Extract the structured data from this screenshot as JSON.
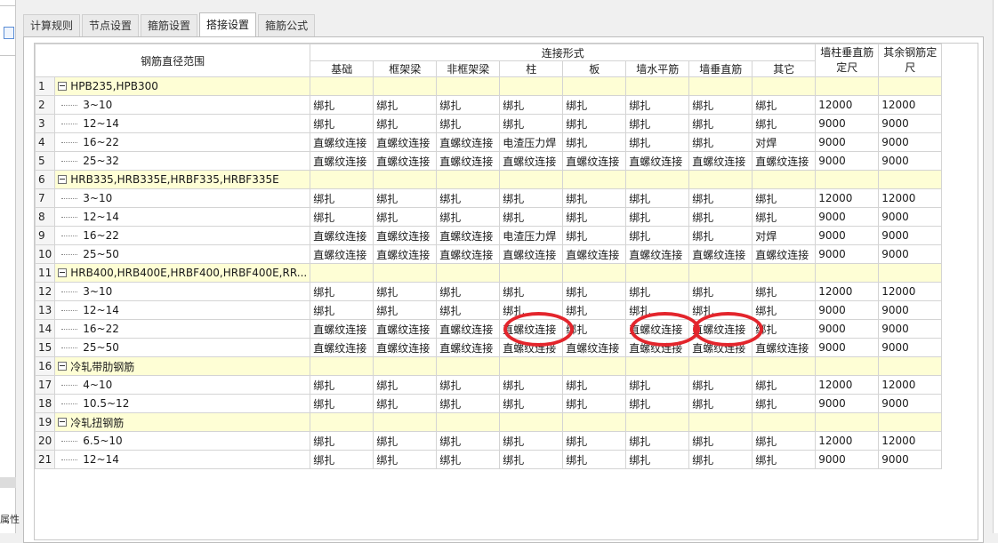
{
  "left_panel": {
    "bottom_text": "属性"
  },
  "tabs": [
    {
      "label": "计算规则"
    },
    {
      "label": "节点设置"
    },
    {
      "label": "箍筋设置"
    },
    {
      "label": "搭接设置",
      "active": true
    },
    {
      "label": "箍筋公式"
    }
  ],
  "table": {
    "headers": {
      "range": "钢筋直径范围",
      "group": "连接形式",
      "sub": [
        "基础",
        "框架梁",
        "非框架梁",
        "柱",
        "板",
        "墙水平筋",
        "墙垂直筋",
        "其它"
      ],
      "wall_col": "墙柱垂直筋定尺",
      "other_col": "其余钢筋定尺"
    },
    "rows": [
      {
        "n": "1",
        "group": true,
        "label": "HPB235,HPB300"
      },
      {
        "n": "2",
        "label": "3~10",
        "cells": [
          "绑扎",
          "绑扎",
          "绑扎",
          "绑扎",
          "绑扎",
          "绑扎",
          "绑扎",
          "绑扎",
          "12000",
          "12000"
        ]
      },
      {
        "n": "3",
        "label": "12~14",
        "cells": [
          "绑扎",
          "绑扎",
          "绑扎",
          "绑扎",
          "绑扎",
          "绑扎",
          "绑扎",
          "绑扎",
          "9000",
          "9000"
        ]
      },
      {
        "n": "4",
        "label": "16~22",
        "cells": [
          "直螺纹连接",
          "直螺纹连接",
          "直螺纹连接",
          "电渣压力焊",
          "绑扎",
          "绑扎",
          "绑扎",
          "对焊",
          "9000",
          "9000"
        ]
      },
      {
        "n": "5",
        "label": "25~32",
        "cells": [
          "直螺纹连接",
          "直螺纹连接",
          "直螺纹连接",
          "直螺纹连接",
          "直螺纹连接",
          "直螺纹连接",
          "直螺纹连接",
          "直螺纹连接",
          "9000",
          "9000"
        ]
      },
      {
        "n": "6",
        "group": true,
        "label": "HRB335,HRB335E,HRBF335,HRBF335E"
      },
      {
        "n": "7",
        "label": "3~10",
        "cells": [
          "绑扎",
          "绑扎",
          "绑扎",
          "绑扎",
          "绑扎",
          "绑扎",
          "绑扎",
          "绑扎",
          "12000",
          "12000"
        ]
      },
      {
        "n": "8",
        "label": "12~14",
        "cells": [
          "绑扎",
          "绑扎",
          "绑扎",
          "绑扎",
          "绑扎",
          "绑扎",
          "绑扎",
          "绑扎",
          "9000",
          "9000"
        ]
      },
      {
        "n": "9",
        "label": "16~22",
        "cells": [
          "直螺纹连接",
          "直螺纹连接",
          "直螺纹连接",
          "电渣压力焊",
          "绑扎",
          "绑扎",
          "绑扎",
          "对焊",
          "9000",
          "9000"
        ]
      },
      {
        "n": "10",
        "label": "25~50",
        "cells": [
          "直螺纹连接",
          "直螺纹连接",
          "直螺纹连接",
          "直螺纹连接",
          "直螺纹连接",
          "直螺纹连接",
          "直螺纹连接",
          "直螺纹连接",
          "9000",
          "9000"
        ]
      },
      {
        "n": "11",
        "group": true,
        "label": "HRB400,HRB400E,HRBF400,HRBF400E,RR..."
      },
      {
        "n": "12",
        "label": "3~10",
        "cells": [
          "绑扎",
          "绑扎",
          "绑扎",
          "绑扎",
          "绑扎",
          "绑扎",
          "绑扎",
          "绑扎",
          "12000",
          "12000"
        ]
      },
      {
        "n": "13",
        "label": "12~14",
        "cells": [
          "绑扎",
          "绑扎",
          "绑扎",
          "绑扎",
          "绑扎",
          "绑扎",
          "绑扎",
          "绑扎",
          "9000",
          "9000"
        ]
      },
      {
        "n": "14",
        "label": "16~22",
        "cells": [
          "直螺纹连接",
          "直螺纹连接",
          "直螺纹连接",
          "直螺纹连接",
          "绑扎",
          "直螺纹连接",
          "直螺纹连接",
          "绑扎",
          "9000",
          "9000"
        ]
      },
      {
        "n": "15",
        "label": "25~50",
        "cells": [
          "直螺纹连接",
          "直螺纹连接",
          "直螺纹连接",
          "直螺纹连接",
          "直螺纹连接",
          "直螺纹连接",
          "直螺纹连接",
          "直螺纹连接",
          "9000",
          "9000"
        ]
      },
      {
        "n": "16",
        "group": true,
        "label": "冷轧带肋钢筋"
      },
      {
        "n": "17",
        "label": "4~10",
        "cells": [
          "绑扎",
          "绑扎",
          "绑扎",
          "绑扎",
          "绑扎",
          "绑扎",
          "绑扎",
          "绑扎",
          "12000",
          "12000"
        ]
      },
      {
        "n": "18",
        "label": "10.5~12",
        "cells": [
          "绑扎",
          "绑扎",
          "绑扎",
          "绑扎",
          "绑扎",
          "绑扎",
          "绑扎",
          "绑扎",
          "9000",
          "9000"
        ]
      },
      {
        "n": "19",
        "group": true,
        "label": "冷轧扭钢筋"
      },
      {
        "n": "20",
        "label": "6.5~10",
        "cells": [
          "绑扎",
          "绑扎",
          "绑扎",
          "绑扎",
          "绑扎",
          "绑扎",
          "绑扎",
          "绑扎",
          "12000",
          "12000"
        ]
      },
      {
        "n": "21",
        "label": "12~14",
        "cells": [
          "绑扎",
          "绑扎",
          "绑扎",
          "绑扎",
          "绑扎",
          "绑扎",
          "绑扎",
          "绑扎",
          "9000",
          "9000"
        ]
      }
    ]
  },
  "annotations": {
    "color": "#e3252c",
    "circled_cells": [
      {
        "row": "14",
        "column": "柱"
      },
      {
        "row": "14",
        "column": "墙水平筋"
      },
      {
        "row": "14",
        "column": "墙垂直筋"
      }
    ]
  }
}
